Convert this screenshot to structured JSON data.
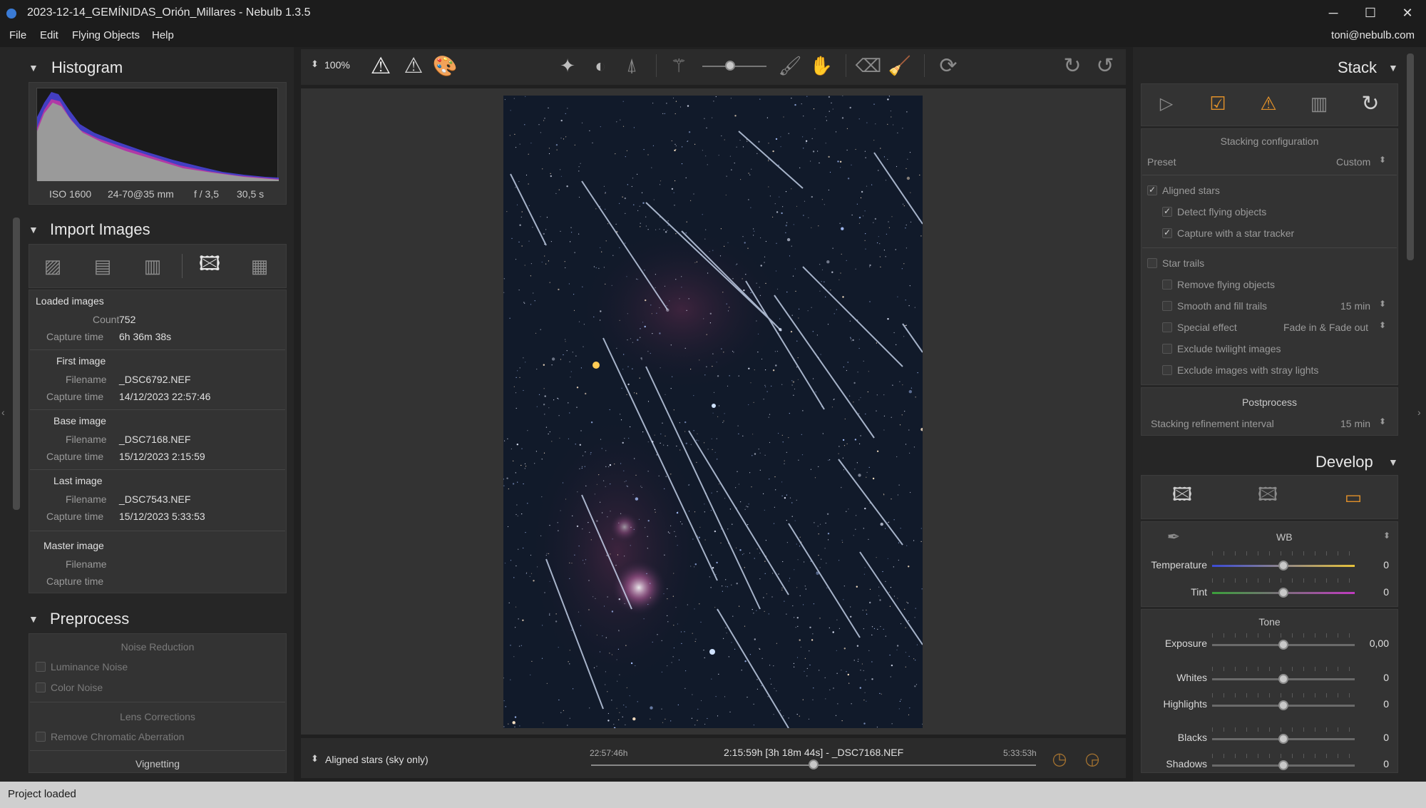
{
  "window": {
    "title": "2023-12-14_GEMÍNIDAS_Orión_Millares - Nebulb 1.3.5",
    "controls": {
      "minimize": "─",
      "maximize": "☐",
      "close": "✕"
    }
  },
  "menubar": {
    "items": [
      "File",
      "Edit",
      "Flying Objects",
      "Help"
    ],
    "user": "toni@nebulb.com"
  },
  "histogram": {
    "title": "Histogram",
    "iso": "ISO 1600",
    "lens": "24-70@35 mm",
    "aperture": "f / 3,5",
    "exposure": "30,5 s"
  },
  "import_images": {
    "title": "Import Images",
    "loaded": {
      "header": "Loaded images",
      "count_label": "Count",
      "count": "752",
      "capture_label": "Capture time",
      "capture": "6h 36m 38s"
    },
    "first": {
      "header": "First image",
      "filename_label": "Filename",
      "filename": "_DSC6792.NEF",
      "capture_label": "Capture time",
      "capture": "14/12/2023 22:57:46"
    },
    "base": {
      "header": "Base image",
      "filename_label": "Filename",
      "filename": "_DSC7168.NEF",
      "capture_label": "Capture time",
      "capture": "15/12/2023 2:15:59"
    },
    "last": {
      "header": "Last image",
      "filename_label": "Filename",
      "filename": "_DSC7543.NEF",
      "capture_label": "Capture time",
      "capture": "15/12/2023 5:33:53"
    },
    "master": {
      "header": "Master image",
      "filename_label": "Filename",
      "capture_label": "Capture time"
    }
  },
  "preprocess": {
    "title": "Preprocess",
    "noise_header": "Noise Reduction",
    "luminance": "Luminance Noise",
    "color": "Color Noise",
    "lens_header": "Lens Corrections",
    "chromatic": "Remove Chromatic Aberration",
    "vignetting": "Vignetting"
  },
  "toolbar": {
    "zoom": "100%"
  },
  "bottom_bar": {
    "mode": "Aligned stars (sky only)",
    "start_time": "22:57:46h",
    "current": "2:15:59h [3h 18m 44s] - _DSC7168.NEF",
    "end_time": "5:33:53h",
    "timeline_position": 0.5
  },
  "stack": {
    "title": "Stack",
    "config_header": "Stacking configuration",
    "preset_label": "Preset",
    "preset_value": "Custom",
    "aligned_stars": "Aligned stars",
    "detect_flying": "Detect flying objects",
    "star_tracker": "Capture with a star tracker",
    "star_trails": "Star trails",
    "remove_flying": "Remove flying objects",
    "smooth_fill": "Smooth and fill trails",
    "smooth_value": "15 min",
    "special_effect": "Special effect",
    "special_value": "Fade in & Fade out",
    "exclude_twilight": "Exclude twilight images",
    "exclude_stray": "Exclude images with stray lights",
    "postprocess_header": "Postprocess",
    "refinement_label": "Stacking refinement interval",
    "refinement_value": "15 min"
  },
  "develop": {
    "title": "Develop",
    "wb_label": "WB",
    "temperature_label": "Temperature",
    "temperature_value": "0",
    "tint_label": "Tint",
    "tint_value": "0",
    "tone_header": "Tone",
    "exposure_label": "Exposure",
    "exposure_value": "0,00",
    "whites_label": "Whites",
    "whites_value": "0",
    "highlights_label": "Highlights",
    "highlights_value": "0",
    "blacks_label": "Blacks",
    "blacks_value": "0",
    "shadows_label": "Shadows",
    "shadows_value": "0"
  },
  "status": {
    "text": "Project loaded"
  }
}
